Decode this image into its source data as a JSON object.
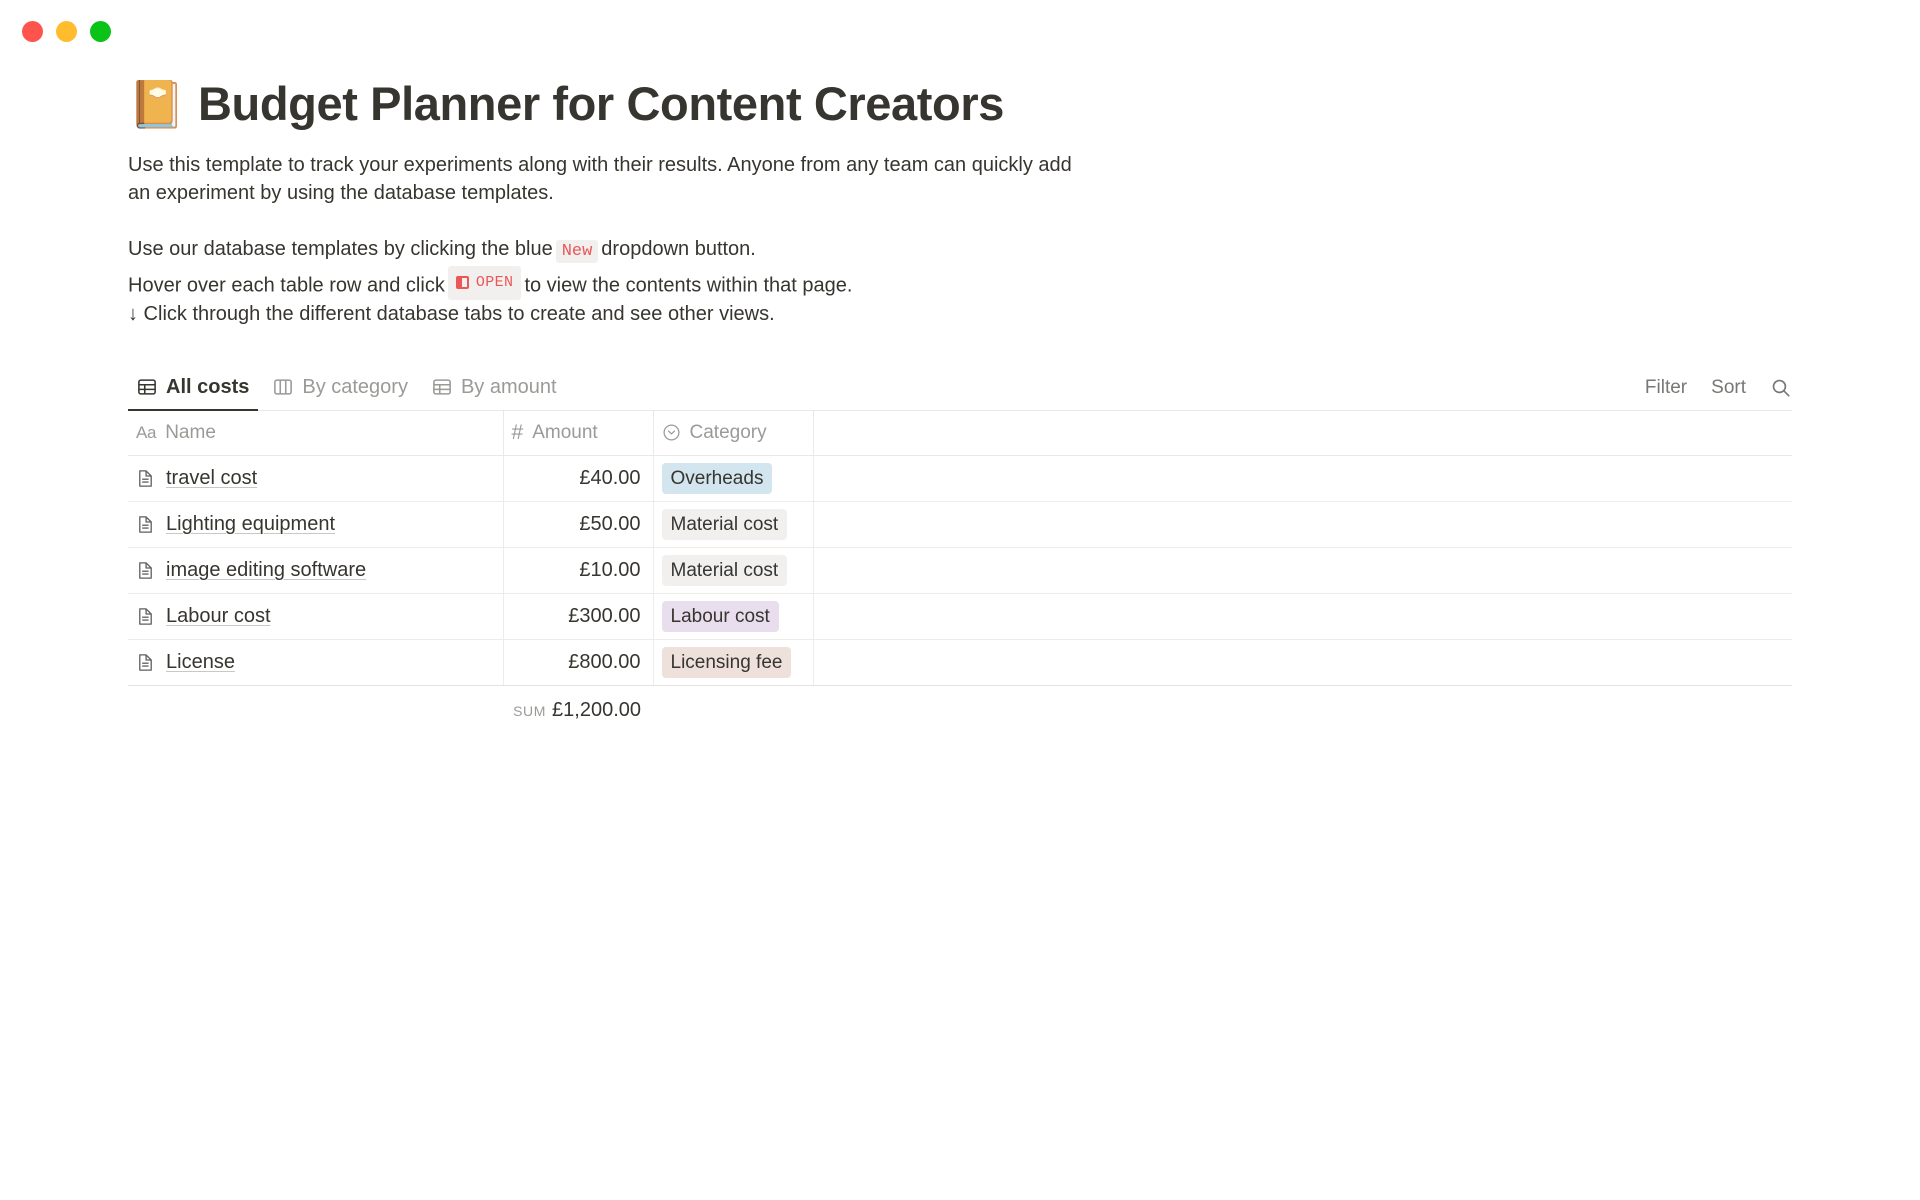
{
  "window": {
    "traffic_lights": [
      {
        "name": "close",
        "color": "#ff544d"
      },
      {
        "name": "minimize",
        "color": "#ffbd2e"
      },
      {
        "name": "zoom",
        "color": "#0ac319"
      }
    ]
  },
  "page": {
    "emoji": "📔",
    "title": "Budget Planner for Content Creators",
    "intro_paragraph": "Use this template to track your experiments along with their results. Anyone from any team can quickly add an experiment by using the database templates.",
    "instructions": {
      "line1_before": "Use our database templates by clicking the blue",
      "line1_badge": "New",
      "line1_after": "dropdown button.",
      "line2_before": "Hover over each table row and click",
      "line2_badge": "OPEN",
      "line2_after": "to view the contents within that page.",
      "line3": "↓ Click through the different database tabs to create and see other views."
    }
  },
  "database": {
    "tabs": [
      {
        "label": "All costs",
        "icon": "table-icon",
        "active": true
      },
      {
        "label": "By category",
        "icon": "board-icon",
        "active": false
      },
      {
        "label": "By amount",
        "icon": "table-icon",
        "active": false
      }
    ],
    "actions": {
      "filter_label": "Filter",
      "sort_label": "Sort",
      "search_icon": "search-icon"
    },
    "columns": [
      {
        "label": "Name",
        "type_icon": "text-type-icon",
        "glyph": "Aa"
      },
      {
        "label": "Amount",
        "type_icon": "number-type-icon",
        "glyph": "#"
      },
      {
        "label": "Category",
        "type_icon": "select-type-icon",
        "glyph": "⌄"
      }
    ],
    "rows": [
      {
        "name": "travel cost",
        "amount": "£40.00",
        "category": "Overheads",
        "category_color": "#d3e5ef"
      },
      {
        "name": "Lighting equipment",
        "amount": "£50.00",
        "category": "Material cost",
        "category_color": "#f1f0ef"
      },
      {
        "name": "image editing software",
        "amount": "£10.00",
        "category": "Material cost",
        "category_color": "#f1f0ef"
      },
      {
        "name": "Labour cost",
        "amount": "£300.00",
        "category": "Labour cost",
        "category_color": "#e8deee"
      },
      {
        "name": "License",
        "amount": "£800.00",
        "category": "Licensing fee",
        "category_color": "#eee0da"
      }
    ],
    "footer": {
      "sum_label": "Sum",
      "sum_value": "£1,200.00"
    }
  }
}
